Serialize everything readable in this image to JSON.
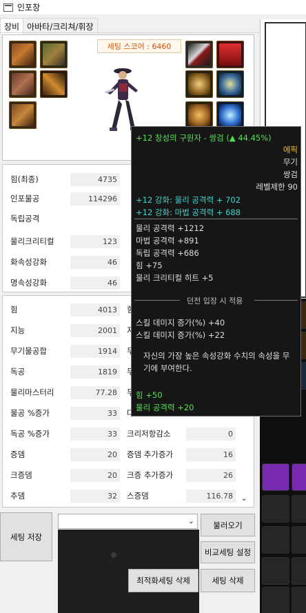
{
  "window": {
    "title": "인포창"
  },
  "tabs": [
    {
      "label": "장비"
    },
    {
      "label": "아바타/크리쳐/휘장"
    }
  ],
  "equip": {
    "score_text": "세팅 스코어 : 6460"
  },
  "stats_top": [
    {
      "label": "힘(최종)",
      "value": "4735"
    },
    {
      "label": "인포물공",
      "value": "114296"
    },
    {
      "label": "독립공격",
      "value": ""
    },
    {
      "label": "물리크리티컬",
      "value": "123"
    },
    {
      "label": "화속성강화",
      "value": "46"
    },
    {
      "label": "명속성강화",
      "value": "46"
    }
  ],
  "stats_bottom_left": [
    {
      "label": "힘",
      "value": "4013"
    },
    {
      "label": "지능",
      "value": "2001"
    },
    {
      "label": "무기물공합",
      "value": "1914"
    },
    {
      "label": "독공",
      "value": "1819"
    },
    {
      "label": "물리마스터리",
      "value": "77.28"
    },
    {
      "label": "물공 %증가",
      "value": "33"
    },
    {
      "label": "독공 %증가",
      "value": "33"
    },
    {
      "label": "증뎀",
      "value": "20"
    },
    {
      "label": "크증뎀",
      "value": "20"
    },
    {
      "label": "추뎀",
      "value": "32"
    }
  ],
  "stats_bottom_right_partial": [
    "힘",
    "지",
    "무",
    "무",
    "무",
    "다",
    "다"
  ],
  "stats_bottom_right": [
    {
      "label": "크리저항감소",
      "value": "0"
    },
    {
      "label": "증뎀 추가증가",
      "value": "16"
    },
    {
      "label": "크증 추가증가",
      "value": "26"
    },
    {
      "label": "스증뎀",
      "value": "116.78"
    }
  ],
  "scroll_down_icon": "chevron-down-icon",
  "buttons": {
    "save": "세팅 저장",
    "load": "불러오기",
    "compare": "비교세팅 설정",
    "optimize_delete": "최적화세팅 삭제",
    "delete": "세팅 삭제"
  },
  "tooltip": {
    "name": "+12 창성의 구원자 - 쌍검 (▲ 44.45%)",
    "rarity": "에픽",
    "category": "무기",
    "type": "쌍검",
    "level_req": "레벨제한 90",
    "reinforce_1": "+12 강화: 물리 공격력 + 702",
    "reinforce_2": "+12 강화: 마법 공격력 + 688",
    "stats": [
      "물리 공격력 +1212",
      "마법 공격력 +891",
      "독립 공격력 +686",
      "힘 +75",
      "물리 크리티컬 히트 +5"
    ],
    "dungeon_header": "던전 입장 시 적용",
    "dungeon_opts": [
      "스킬 데미지 증가(%) +40",
      "스킬 데미지 증가(%) +22"
    ],
    "desc_1": "자신의 가장 높은 속성강화 수치의 속성을 무",
    "desc_2": "기에 부여한다.",
    "bonus_1": "힘 +50",
    "bonus_2": "물리 공격력 +20"
  },
  "colors": {
    "tooltip_green": "#55e055",
    "tooltip_cyan": "#3fd4cf",
    "rarity_epic": "#f0c020",
    "score_text": "#d35400"
  }
}
